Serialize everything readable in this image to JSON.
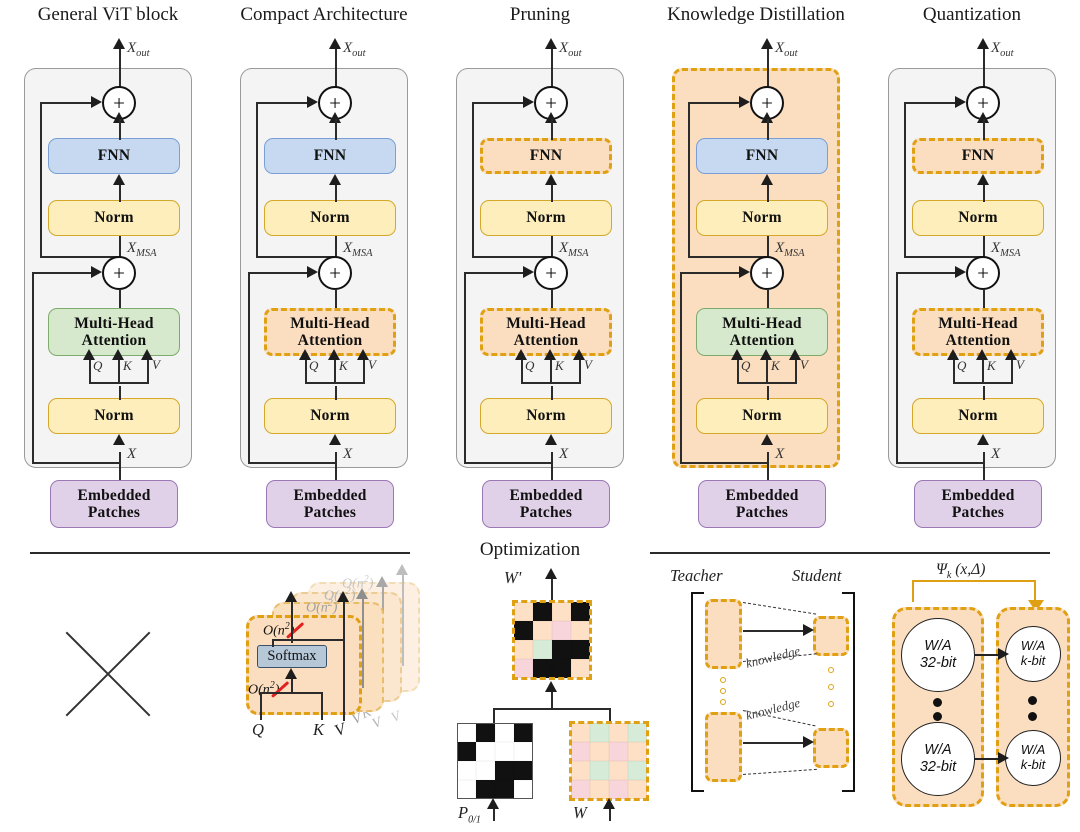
{
  "figure": {
    "divider_label": "Optimization",
    "columns": [
      {
        "id": "general",
        "title": "General ViT block",
        "blocks": {
          "fnn": "FNN",
          "norm_top": "Norm",
          "attention": "Multi-Head\nAttention",
          "norm_bottom": "Norm",
          "embedded": "Embedded\nPatches"
        },
        "signals": {
          "x_out": "X",
          "x_out_sub": "out",
          "x_msa": "X",
          "x_msa_sub": "MSA",
          "x_in": "X",
          "q": "Q",
          "k": "K",
          "v": "V"
        },
        "highlighted": "none"
      },
      {
        "id": "compact",
        "title": "Compact Architecture",
        "blocks": {
          "fnn": "FNN",
          "norm_top": "Norm",
          "attention": "Multi-Head\nAttention",
          "norm_bottom": "Norm",
          "embedded": "Embedded\nPatches"
        },
        "signals": {
          "x_out": "X",
          "x_out_sub": "out",
          "x_msa": "X",
          "x_msa_sub": "MSA",
          "x_in": "X",
          "q": "Q",
          "k": "K",
          "v": "V"
        },
        "highlighted": "attention"
      },
      {
        "id": "pruning",
        "title": "Pruning",
        "blocks": {
          "fnn": "FNN",
          "norm_top": "Norm",
          "attention": "Multi-Head\nAttention",
          "norm_bottom": "Norm",
          "embedded": "Embedded\nPatches"
        },
        "signals": {
          "x_out": "X",
          "x_out_sub": "out",
          "x_msa": "X",
          "x_msa_sub": "MSA",
          "x_in": "X",
          "q": "Q",
          "k": "K",
          "v": "V"
        },
        "highlighted": "fnn+attention"
      },
      {
        "id": "distillation",
        "title": "Knowledge Distillation",
        "blocks": {
          "fnn": "FNN",
          "norm_top": "Norm",
          "attention": "Multi-Head\nAttention",
          "norm_bottom": "Norm",
          "embedded": "Embedded\nPatches"
        },
        "signals": {
          "x_out": "X",
          "x_out_sub": "out",
          "x_msa": "X",
          "x_msa_sub": "MSA",
          "x_in": "X",
          "q": "Q",
          "k": "K",
          "v": "V"
        },
        "highlighted": "whole-block"
      },
      {
        "id": "quantization",
        "title": "Quantization",
        "blocks": {
          "fnn": "FNN",
          "norm_top": "Norm",
          "attention": "Multi-Head\nAttention",
          "norm_bottom": "Norm",
          "embedded": "Embedded\nPatches"
        },
        "signals": {
          "x_out": "X",
          "x_out_sub": "out",
          "x_msa": "X",
          "x_msa_sub": "MSA",
          "x_in": "X",
          "q": "Q",
          "k": "K",
          "v": "V"
        },
        "highlighted": "fnn+attention"
      }
    ],
    "optimization": {
      "general": {
        "symbol": "X",
        "description": "no optimization (crossed out)"
      },
      "compact": {
        "softmax_label": "Softmax",
        "complexity_top": "O(n²)",
        "complexity_bottom": "O(n²)",
        "inputs": [
          "Q",
          "K",
          "V"
        ],
        "ghost_inputs": [
          "Q",
          "K",
          "V",
          "K",
          "V",
          "V"
        ],
        "strikethrough_color": "#e32020"
      },
      "pruning": {
        "output_label": "W'",
        "mask_label": "P",
        "mask_label_sub": "0/1",
        "weight_label": "W",
        "mask_matrix": [
          [
            1,
            0,
            1,
            0
          ],
          [
            0,
            1,
            1,
            1
          ],
          [
            1,
            1,
            0,
            0
          ],
          [
            1,
            0,
            0,
            1
          ]
        ],
        "result_matrix": [
          [
            "o",
            0,
            "o",
            0
          ],
          [
            0,
            "o",
            "p",
            "o"
          ],
          [
            "o",
            "g",
            0,
            0
          ],
          [
            "p",
            0,
            0,
            "o"
          ]
        ],
        "weight_matrix": [
          [
            "o",
            "g",
            "o",
            "g"
          ],
          [
            "p",
            "o",
            "p",
            "o"
          ],
          [
            "o",
            "g",
            "o",
            "g"
          ],
          [
            "p",
            "o",
            "p",
            "o"
          ]
        ],
        "cell_colors": {
          "o": "#fde0c5",
          "g": "#d6ebd8",
          "p": "#f7d5da",
          "black": "#111111",
          "white": "#ffffff"
        }
      },
      "distillation": {
        "teacher_label": "Teacher",
        "student_label": "Student",
        "knowledge_label_1": "knowledge",
        "knowledge_label_2": "knowledge"
      },
      "quantization": {
        "function_label": "Ψ",
        "function_sub": "k",
        "function_args": "(x,Δ)",
        "source_nodes": [
          {
            "line1": "W/A",
            "line2": "32-bit"
          },
          {
            "line1": "W/A",
            "line2": "32-bit"
          }
        ],
        "target_nodes": [
          {
            "line1": "W/A",
            "line2": "k-bit"
          },
          {
            "line1": "W/A",
            "line2": "k-bit"
          }
        ]
      }
    },
    "colors": {
      "fnn": "#c6d9f0",
      "norm": "#fdeebb",
      "attention": "#d7e9cd",
      "embedded": "#e0d0e8",
      "highlight_fill": "#fbddbf",
      "highlight_border": "#e0a013",
      "frame": "#f4f4f4",
      "softmax": "#b6c8d8"
    }
  }
}
